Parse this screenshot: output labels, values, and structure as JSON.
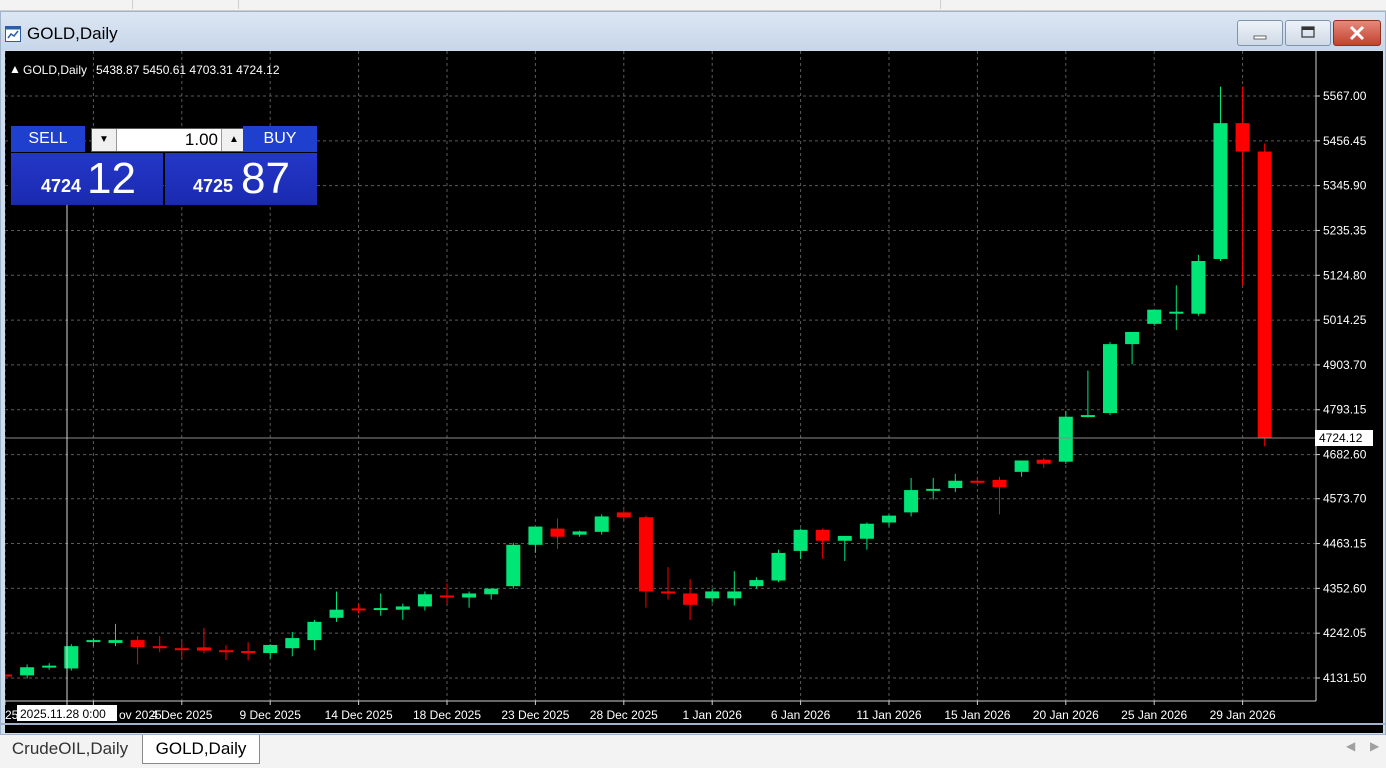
{
  "window": {
    "title": "GOLD,Daily"
  },
  "chart_info": {
    "symbol": "GOLD,Daily",
    "ohlc": "5438.87 5450.61 4703.31 4724.12"
  },
  "trade_panel": {
    "sell_label": "SELL",
    "buy_label": "BUY",
    "lot": "1.00",
    "sell_price_small": "4724",
    "sell_price_big": "12",
    "buy_price_small": "4725",
    "buy_price_big": "87"
  },
  "crosshair_label": "2025.11.28 0:00",
  "time_axis_partial": {
    "left": "25",
    "right": "ov 2025"
  },
  "tabs": [
    {
      "label": "CrudeOIL,Daily"
    },
    {
      "label": "GOLD,Daily"
    }
  ],
  "colors": {
    "bull": "#00e676",
    "bear": "#ff0000",
    "background": "#000000",
    "panel": "#1f3fcf"
  },
  "chart_data": {
    "type": "candlestick",
    "title": "GOLD,Daily",
    "current_price": 4724.12,
    "ylim": [
      4075,
      5620
    ],
    "y_ticks": [
      4131.5,
      4242.05,
      4352.6,
      4463.15,
      4573.7,
      4682.6,
      4793.15,
      4903.7,
      5014.25,
      5124.8,
      5235.35,
      5345.9,
      5456.45,
      5567.0
    ],
    "y_tick_labels": [
      "4131.50",
      "4242.05",
      "4352.60",
      "4463.15",
      "4573.70",
      "4682.60",
      "4793.15",
      "4903.70",
      "5014.25",
      "5124.80",
      "5235.35",
      "5345.90",
      "5456.45",
      "5567.00"
    ],
    "x_labels": [
      "4 Dec 2025",
      "9 Dec 2025",
      "14 Dec 2025",
      "18 Dec 2025",
      "23 Dec 2025",
      "28 Dec 2025",
      "1 Jan 2026",
      "6 Jan 2026",
      "11 Jan 2026",
      "15 Jan 2026",
      "20 Jan 2026",
      "25 Jan 2026",
      "29 Jan 2026"
    ],
    "candles": [
      {
        "o": 4140,
        "h": 4155,
        "l": 4125,
        "c": 4135
      },
      {
        "o": 4138,
        "h": 4165,
        "l": 4130,
        "c": 4158
      },
      {
        "o": 4160,
        "h": 4168,
        "l": 4152,
        "c": 4162
      },
      {
        "o": 4155,
        "h": 4215,
        "l": 4150,
        "c": 4210
      },
      {
        "o": 4222,
        "h": 4230,
        "l": 4210,
        "c": 4225
      },
      {
        "o": 4218,
        "h": 4265,
        "l": 4210,
        "c": 4225
      },
      {
        "o": 4225,
        "h": 4235,
        "l": 4165,
        "c": 4208
      },
      {
        "o": 4210,
        "h": 4235,
        "l": 4195,
        "c": 4205
      },
      {
        "o": 4205,
        "h": 4220,
        "l": 4180,
        "c": 4203
      },
      {
        "o": 4207,
        "h": 4255,
        "l": 4192,
        "c": 4199
      },
      {
        "o": 4200,
        "h": 4212,
        "l": 4176,
        "c": 4198
      },
      {
        "o": 4198,
        "h": 4220,
        "l": 4175,
        "c": 4195
      },
      {
        "o": 4193,
        "h": 4215,
        "l": 4180,
        "c": 4213
      },
      {
        "o": 4205,
        "h": 4245,
        "l": 4185,
        "c": 4230
      },
      {
        "o": 4225,
        "h": 4275,
        "l": 4200,
        "c": 4270
      },
      {
        "o": 4280,
        "h": 4345,
        "l": 4270,
        "c": 4300
      },
      {
        "o": 4303,
        "h": 4315,
        "l": 4290,
        "c": 4302
      },
      {
        "o": 4300,
        "h": 4340,
        "l": 4285,
        "c": 4304
      },
      {
        "o": 4300,
        "h": 4315,
        "l": 4275,
        "c": 4308
      },
      {
        "o": 4308,
        "h": 4345,
        "l": 4298,
        "c": 4338
      },
      {
        "o": 4335,
        "h": 4365,
        "l": 4315,
        "c": 4332
      },
      {
        "o": 4330,
        "h": 4345,
        "l": 4305,
        "c": 4340
      },
      {
        "o": 4338,
        "h": 4350,
        "l": 4325,
        "c": 4352
      },
      {
        "o": 4358,
        "h": 4465,
        "l": 4352,
        "c": 4460
      },
      {
        "o": 4460,
        "h": 4505,
        "l": 4440,
        "c": 4505
      },
      {
        "o": 4500,
        "h": 4525,
        "l": 4450,
        "c": 4480
      },
      {
        "o": 4485,
        "h": 4495,
        "l": 4480,
        "c": 4493
      },
      {
        "o": 4492,
        "h": 4535,
        "l": 4485,
        "c": 4530
      },
      {
        "o": 4540,
        "h": 4545,
        "l": 4520,
        "c": 4528
      },
      {
        "o": 4528,
        "h": 4532,
        "l": 4305,
        "c": 4345
      },
      {
        "o": 4345,
        "h": 4405,
        "l": 4325,
        "c": 4340
      },
      {
        "o": 4340,
        "h": 4375,
        "l": 4275,
        "c": 4312
      },
      {
        "o": 4328,
        "h": 4352,
        "l": 4318,
        "c": 4345
      },
      {
        "o": 4328,
        "h": 4395,
        "l": 4310,
        "c": 4345
      },
      {
        "o": 4358,
        "h": 4380,
        "l": 4352,
        "c": 4373
      },
      {
        "o": 4372,
        "h": 4448,
        "l": 4368,
        "c": 4440
      },
      {
        "o": 4445,
        "h": 4500,
        "l": 4425,
        "c": 4497
      },
      {
        "o": 4497,
        "h": 4500,
        "l": 4425,
        "c": 4470
      },
      {
        "o": 4470,
        "h": 4480,
        "l": 4420,
        "c": 4482
      },
      {
        "o": 4475,
        "h": 4515,
        "l": 4448,
        "c": 4512
      },
      {
        "o": 4515,
        "h": 4535,
        "l": 4505,
        "c": 4532
      },
      {
        "o": 4540,
        "h": 4625,
        "l": 4530,
        "c": 4595
      },
      {
        "o": 4598,
        "h": 4625,
        "l": 4572,
        "c": 4598
      },
      {
        "o": 4600,
        "h": 4635,
        "l": 4590,
        "c": 4618
      },
      {
        "o": 4618,
        "h": 4625,
        "l": 4605,
        "c": 4613
      },
      {
        "o": 4620,
        "h": 4628,
        "l": 4535,
        "c": 4602
      },
      {
        "o": 4640,
        "h": 4668,
        "l": 4628,
        "c": 4668
      },
      {
        "o": 4670,
        "h": 4674,
        "l": 4650,
        "c": 4660
      },
      {
        "o": 4665,
        "h": 4790,
        "l": 4660,
        "c": 4776
      },
      {
        "o": 4776,
        "h": 4890,
        "l": 4774,
        "c": 4780
      },
      {
        "o": 4785,
        "h": 4960,
        "l": 4780,
        "c": 4955
      },
      {
        "o": 4955,
        "h": 4985,
        "l": 4905,
        "c": 4985
      },
      {
        "o": 5005,
        "h": 5040,
        "l": 5000,
        "c": 5040
      },
      {
        "o": 5030,
        "h": 5100,
        "l": 4990,
        "c": 5035
      },
      {
        "o": 5030,
        "h": 5175,
        "l": 5025,
        "c": 5160
      },
      {
        "o": 5165,
        "h": 5590,
        "l": 5160,
        "c": 5500
      },
      {
        "o": 5500,
        "h": 5590,
        "l": 5100,
        "c": 5430
      },
      {
        "o": 5430,
        "h": 5450,
        "l": 4703,
        "c": 4724
      }
    ]
  }
}
